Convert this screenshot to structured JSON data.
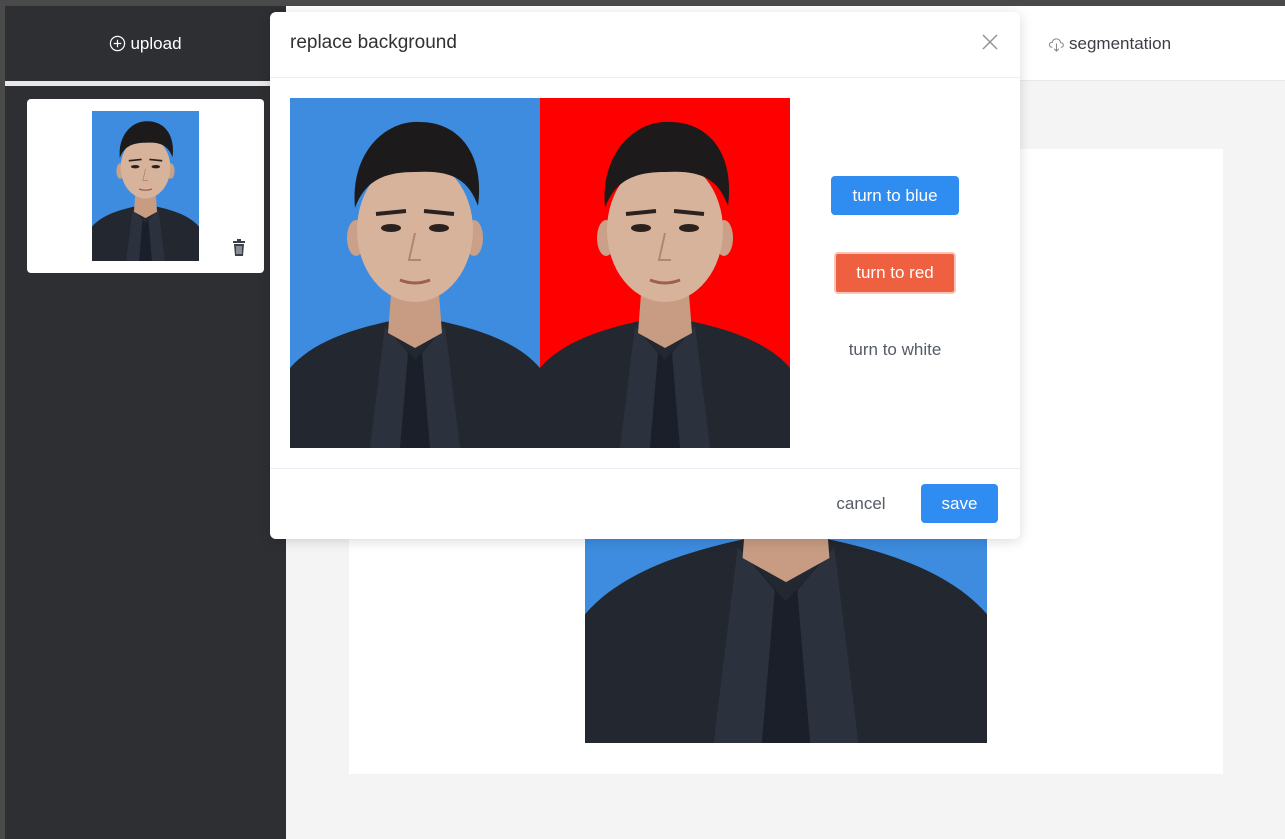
{
  "sidebar": {
    "upload_label": "upload",
    "upload_icon": "plus-circle-icon",
    "delete_icon": "trash-icon",
    "background_color": "#2e2f33"
  },
  "toolbar": {
    "segmentation_label": "segmentation",
    "segmentation_icon": "cloud-download-icon"
  },
  "dialog": {
    "title": "replace background",
    "close_icon": "close-icon",
    "buttons": {
      "blue_label": "turn to blue",
      "red_label": "turn to red",
      "white_label": "turn to white",
      "cancel_label": "cancel",
      "save_label": "save"
    }
  },
  "colors": {
    "accent_blue": "#2f8cf0",
    "accent_red": "#ee6040",
    "photo_blue_bg": "#3d8cdf",
    "photo_red_bg": "#ff0000"
  }
}
